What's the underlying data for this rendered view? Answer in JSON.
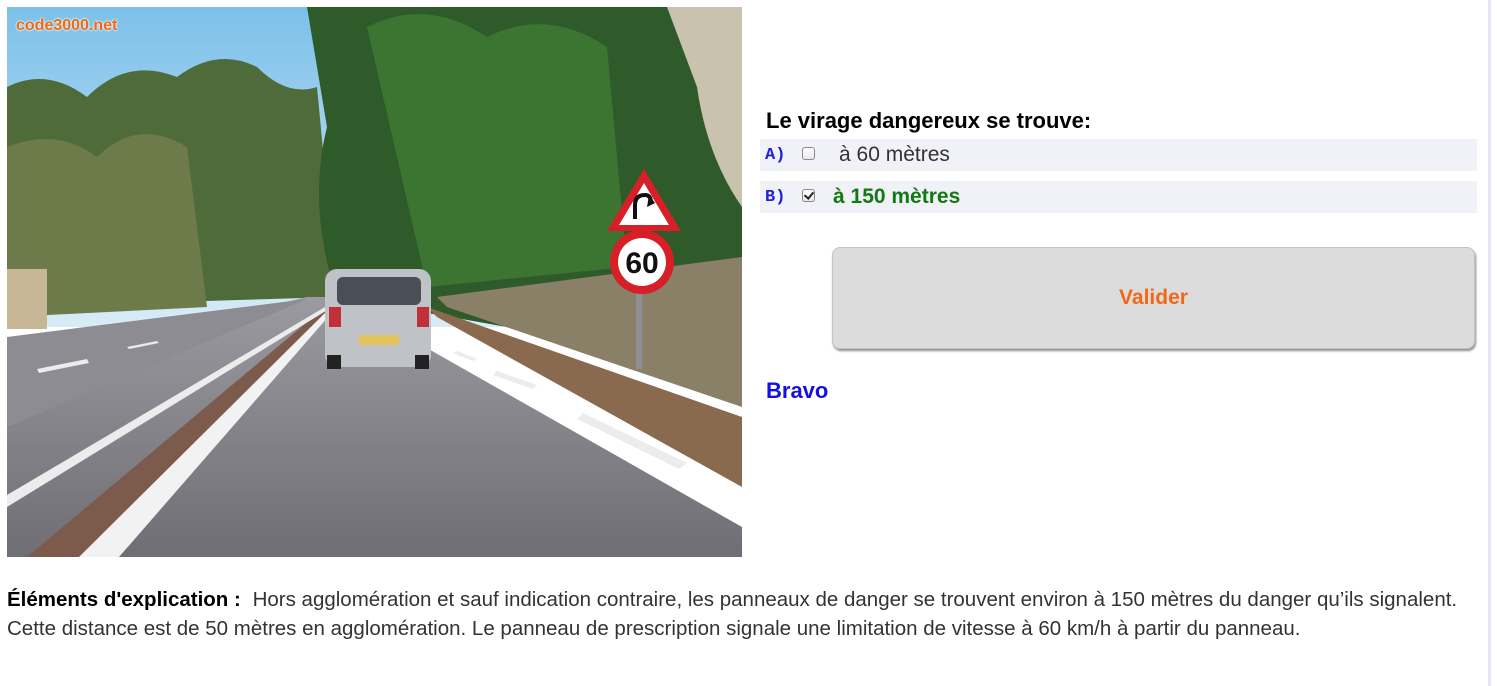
{
  "photo": {
    "watermark": "code3000.net",
    "speed_sign_value": "60",
    "sign_colors": {
      "red": "#d61f26",
      "white": "#ffffff"
    }
  },
  "question": {
    "title": "Le virage dangereux se trouve:",
    "answers": [
      {
        "letter": "A)",
        "text": "à 60 mètres",
        "checked": false
      },
      {
        "letter": "B)",
        "text": "à 150 mètres",
        "checked": true
      }
    ]
  },
  "validate_button": {
    "label": "Valider"
  },
  "result": {
    "text": "Bravo"
  },
  "explanation": {
    "label": "Éléments d'explication :",
    "text": "Hors agglomération et sauf indication contraire, les panneaux de danger se trouvent environ à 150 mètres du danger qu’ils signalent. Cette distance est de 50 mètres en agglomération. Le panneau de prescription signale une limitation de vitesse à 60 km/h à partir du panneau."
  },
  "colors": {
    "answer_letter": "#2020d8",
    "correct_answer": "#127a12",
    "validate_label": "#f26818",
    "result": "#1212e0",
    "watermark": "#f06a10"
  }
}
